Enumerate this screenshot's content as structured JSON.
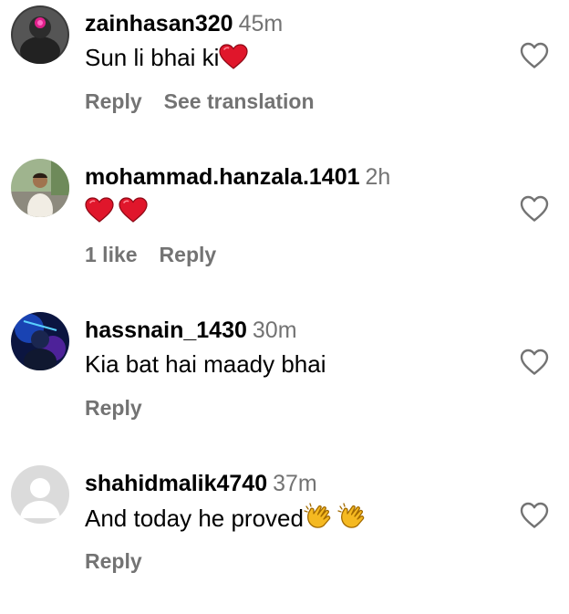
{
  "comments": [
    {
      "username": "zainhasan320",
      "time": "45m",
      "text": "Sun li bhai ki",
      "emoji": "heart",
      "actions": {
        "reply": "Reply",
        "translate": "See translation"
      },
      "avatar": "portrait-dark-pink-light"
    },
    {
      "username": "mohammad.hanzala.1401",
      "time": "2h",
      "text": "",
      "emoji": "heart-heart",
      "actions": {
        "likes": "1 like",
        "reply": "Reply"
      },
      "avatar": "portrait-man-white-kurta"
    },
    {
      "username": "hassnain_1430",
      "time": "30m",
      "text": "Kia bat hai maady bhai",
      "emoji": "",
      "actions": {
        "reply": "Reply"
      },
      "avatar": "portrait-blue-neon"
    },
    {
      "username": "shahidmalik4740",
      "time": "37m",
      "text": "And today he proved",
      "emoji": "clap-clap",
      "actions": {
        "reply": "Reply"
      },
      "avatar": "default-avatar"
    }
  ],
  "colors": {
    "text": "#000000",
    "secondary": "#737373",
    "heart_emoji": "#e0162b",
    "clap_emoji": "#f5b921"
  },
  "icons": {
    "like": "heart-outline-icon"
  }
}
